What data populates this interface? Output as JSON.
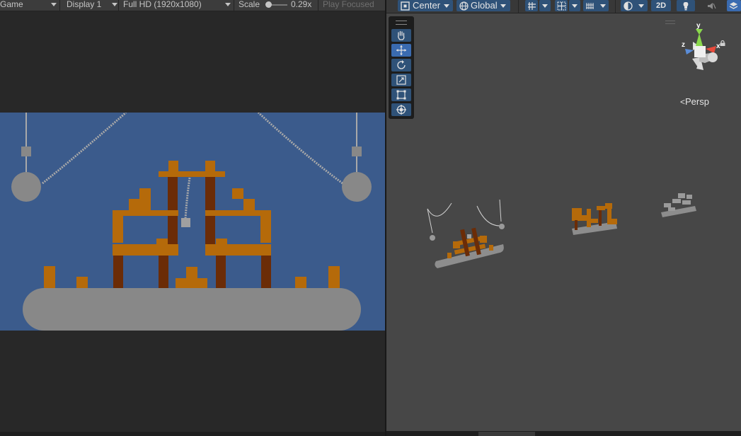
{
  "game_view": {
    "toolbar": {
      "tab_label": "Game",
      "display_label": "Display 1",
      "resolution_label": "Full HD (1920x1080)",
      "scale_label": "Scale",
      "scale_value": "0.29x",
      "play_focused_label": "Play Focused"
    },
    "colors": {
      "sky": "#3b5b8c",
      "platform": "#888888",
      "wood_light": "#b56a0a",
      "wood_dark": "#6b2c07",
      "chain": "#a9a9a9"
    }
  },
  "scene_view": {
    "toolbar": {
      "pivot_mode_label": "Center",
      "pivot_rotation_label": "Global",
      "mode_2d_label": "2D",
      "icons": [
        "grid-snap-icon",
        "increment-snap-icon",
        "grid-visibility-icon",
        "draw-mode-icon",
        "lighting-icon",
        "audio-icon",
        "effects-icon"
      ]
    },
    "tools": [
      "hand-tool",
      "move-tool",
      "rotate-tool",
      "scale-tool",
      "rect-tool",
      "transform-tool"
    ],
    "active_tool": "move-tool",
    "gizmo": {
      "axis_y": "y",
      "axis_x": "x",
      "axis_z": "z",
      "projection_label": "Persp"
    }
  }
}
